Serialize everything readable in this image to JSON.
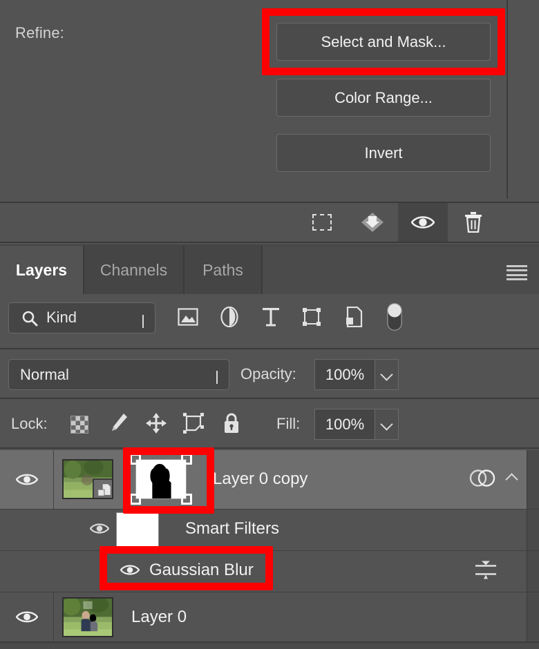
{
  "refine": {
    "label": "Refine:",
    "buttons": [
      {
        "label": "Select and Mask...",
        "name": "select-and-mask",
        "highlighted": true
      },
      {
        "label": "Color Range...",
        "name": "color-range",
        "highlighted": false
      },
      {
        "label": "Invert",
        "name": "invert",
        "highlighted": false
      }
    ]
  },
  "mask_toolbar": {
    "icons": [
      {
        "name": "load-selection-from-mask-icon",
        "title": "Load selection from mask"
      },
      {
        "name": "apply-mask-icon",
        "title": "Apply mask"
      },
      {
        "name": "toggle-mask-visibility-icon",
        "title": "Toggle mask on/off",
        "active": true
      },
      {
        "name": "delete-mask-icon",
        "title": "Delete mask"
      }
    ]
  },
  "panel": {
    "tabs": [
      {
        "label": "Layers",
        "active": true
      },
      {
        "label": "Channels",
        "active": false
      },
      {
        "label": "Paths",
        "active": false
      }
    ],
    "menu_icon": "panel-menu-icon"
  },
  "filter": {
    "search_icon": "search-icon",
    "kind_label": "Kind",
    "chevron_icon": "chevron-down-icon",
    "type_icons": [
      {
        "name": "filter-pixel-layers-icon"
      },
      {
        "name": "filter-adjustment-layers-icon"
      },
      {
        "name": "filter-type-layers-icon"
      },
      {
        "name": "filter-shape-layers-icon"
      },
      {
        "name": "filter-smart-object-layers-icon"
      }
    ],
    "toggle": {
      "name": "filter-enable-toggle",
      "state": "on"
    }
  },
  "blend": {
    "mode": "Normal",
    "opacity_label": "Opacity:",
    "opacity_value": "100%"
  },
  "lock": {
    "label": "Lock:",
    "icons": [
      {
        "name": "lock-transparent-pixels-icon"
      },
      {
        "name": "lock-image-pixels-icon"
      },
      {
        "name": "lock-position-icon"
      },
      {
        "name": "lock-artboard-nesting-icon"
      },
      {
        "name": "lock-all-icon"
      }
    ],
    "fill_label": "Fill:",
    "fill_value": "100%"
  },
  "layers": [
    {
      "name": "Layer 0 copy",
      "visible": true,
      "selected": true,
      "has_smart_object_badge": true,
      "has_layer_mask": true,
      "mask_selected": true,
      "mask_highlighted": true,
      "smart_filter_icon": "smart-filters-icon",
      "collapse_icon": "chevron-up-icon"
    },
    {
      "name": "Smart Filters",
      "visible": true,
      "is_smart_filter_group": true,
      "has_filter_mask": true
    },
    {
      "name": "Gaussian Blur",
      "visible": true,
      "is_filter_entry": true,
      "highlighted": true,
      "settings_icon": "blending-options-icon"
    },
    {
      "name": "Layer 0",
      "visible": true,
      "selected": false,
      "has_thumbnail": true
    }
  ],
  "colors": {
    "panel_bg": "#535353",
    "row_selected_bg": "#6E6E6E",
    "tab_inactive_bg": "#454545",
    "field_bg": "#454545",
    "divider": "#3A3A3A",
    "text": "#F2F2F2",
    "text_muted": "#A8A8A8",
    "highlight": "#FF0000"
  }
}
